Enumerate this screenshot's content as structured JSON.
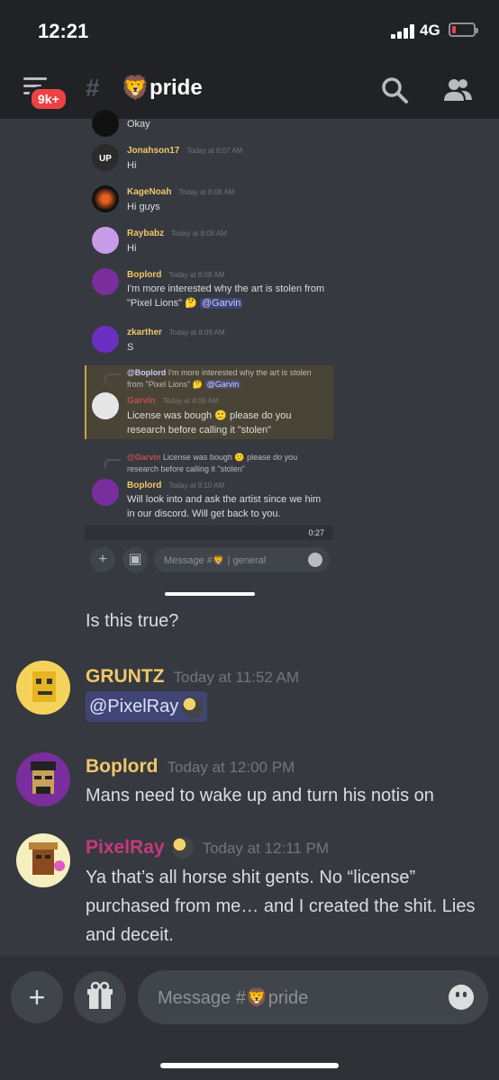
{
  "status_bar": {
    "time": "12:21",
    "network": "4G"
  },
  "header": {
    "unread_badge": "9k+",
    "channel_emoji": "🦁",
    "channel_name": "pride"
  },
  "embedded_screenshot": {
    "messages": [
      {
        "text": "Okay"
      },
      {
        "author": "Jonahson17",
        "time": "Today at 8:07 AM",
        "text": "Hi",
        "avatar_text": "UP"
      },
      {
        "author": "KageNoah",
        "time": "Today at 8:08 AM",
        "text": "Hi guys"
      },
      {
        "author": "Raybabz",
        "time": "Today at 8:08 AM",
        "text": "Hi"
      },
      {
        "author": "Boplord",
        "time": "Today at 8:08 AM",
        "text": "I'm more interested why the art is stolen from \"Pixel Lions\" 🤔",
        "mention": "@Garvin"
      },
      {
        "author": "zkarther",
        "time": "Today at 8:09 AM",
        "text": "S"
      },
      {
        "reply_author": "@Boplord",
        "reply_text": "I'm more interested why the art is stolen from \"Pixel Lions\" 🤔",
        "reply_mention": "@Garvin",
        "author": "Garvin",
        "time": "Today at 8:09 AM",
        "text": "License was bough 🙂 please do you research before calling it \"stolen\""
      },
      {
        "reply_author": "@Garvin",
        "reply_text": "License was bough 🙂 please do you research before calling it \"stolen\"",
        "author": "Boplord",
        "time": "Today at 8:10 AM",
        "text": "Will look into and ask the artist since we him in our discord. Will get back to you."
      }
    ],
    "video_time": "0:27",
    "input_placeholder": "Message #🦁 | general"
  },
  "messages": [
    {
      "text": "Is this true?"
    },
    {
      "author": "GRUNTZ",
      "time": "Today at 11:52 AM",
      "text": "@PixelRay"
    },
    {
      "author": "Boplord",
      "time": "Today at 12:00 PM",
      "text": "Mans need to wake up and turn his notis on"
    },
    {
      "author": "PixelRay",
      "time": "Today at 12:11 PM",
      "text": "Ya that’s all horse shit gents. No “license” purchased from me… and I created the shit. Lies and deceit."
    }
  ],
  "composer": {
    "placeholder": "Message #🦁pride",
    "add_icon": "plus-icon",
    "gift_icon": "gift-icon"
  },
  "colors": {
    "background": "#36393f",
    "header": "#202225",
    "gold_name": "#f0c86a",
    "red_name": "#c0504d",
    "pink_name": "#c63a7c",
    "mention": "#5865f2"
  }
}
